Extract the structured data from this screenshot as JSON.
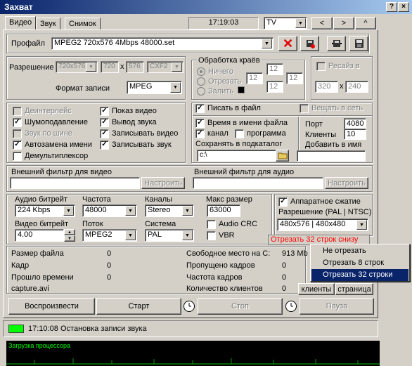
{
  "window": {
    "title": "Захват",
    "btn_help": "?",
    "btn_close": "×"
  },
  "tabs": {
    "video": "Видео",
    "sound": "Звук",
    "snapshot": "Снимок"
  },
  "toolbar": {
    "time": "17:19:03",
    "tv_value": "TV",
    "prev": "<",
    "next": ">",
    "up": "^"
  },
  "profile": {
    "label": "Профайл",
    "value": "MPEG2 720x576 4Mbps 48000.set"
  },
  "resolution": {
    "label": "Разрешение",
    "w_select": "720x576",
    "w": "720",
    "x": "x",
    "h": "576",
    "cxf": "CXF2"
  },
  "record_format": {
    "label": "Формат записи",
    "value": "MPEG"
  },
  "edges": {
    "title": "Обработка краёв",
    "nothing": "Ничего",
    "cut": "Отрезать",
    "fill": "Залить",
    "t": "12",
    "l": "12",
    "r": "12",
    "b": "12"
  },
  "resize": {
    "label": "Ресайз в",
    "w": "320",
    "x": "x",
    "h": "240"
  },
  "options_left": [
    "Деинтерлейс",
    "Шумоподавление",
    "Звук по шине",
    "Автозамена имени",
    "Демультиплексор"
  ],
  "options_left_checked": [
    false,
    true,
    false,
    true,
    false
  ],
  "options_right": [
    "Показ видео",
    "Вывод звука",
    "Записывать видео",
    "Записывать звук"
  ],
  "write_file": {
    "label": "Писать в файл",
    "net": "Вещать в сеть",
    "time_in_name": "Время в имени файла",
    "channel": "канал",
    "program": "программа",
    "save_subdir": "Сохранять в подкаталог",
    "path": "c:\\"
  },
  "net": {
    "port_label": "Порт",
    "port": "4080",
    "clients_label": "Клиенты",
    "clients": "10",
    "add_name": "Добавить в имя"
  },
  "filters": {
    "video_label": "Внешний фильтр для видео",
    "audio_label": "Внешний фильтр для аудио",
    "configure": "Настроить"
  },
  "audio": {
    "bitrate_label": "Аудио битрейт",
    "bitrate": "224 Kbps",
    "freq_label": "Частота",
    "freq": "48000",
    "channels_label": "Каналы",
    "channels": "Stereo",
    "maxsize_label": "Макс размер",
    "maxsize": "63000",
    "video_bitrate_label": "Видео битрейт",
    "video_bitrate": "4.00",
    "stream_label": "Поток",
    "stream": "MPEG2",
    "system_label": "Система",
    "system": "PAL",
    "audio_crc": "Audio CRC",
    "vbr": "VBR"
  },
  "hw": {
    "label": "Аппаратное сжатие",
    "res_label": "Разрешение (PAL | NTSC)",
    "res": "480x576 | 480x480",
    "cut_text": "Отрезать 32 строк снизу"
  },
  "menu": {
    "items": [
      "Не отрезать",
      "Отрезать 8 строк",
      "Отрезать 32 строки"
    ]
  },
  "stats": {
    "filesize_label": "Размер файла",
    "filesize": "0",
    "frame_label": "Кадр",
    "frame": "0",
    "elapsed_label": "Прошло времени",
    "elapsed": "0",
    "filename": "capture.avi",
    "free_label": "Свободное место на C:",
    "free": "913 Mb",
    "dropped_label": "Пропущено кадров",
    "dropped": "0",
    "rate_label": "Частота кадров",
    "rate": "0",
    "clients_label": "Количество клиентов",
    "clients": "0",
    "clients_btn": "клиенты",
    "page_btn": "страница"
  },
  "actions": {
    "play": "Воспроизвести",
    "start": "Старт",
    "stop": "Стоп",
    "pause": "Пауза"
  },
  "status": {
    "time": "17:10:08",
    "text": "Остановка записи звука"
  },
  "cpu": {
    "label": "Загрузка процессора"
  },
  "colors": {
    "titlebar": "#0a246a",
    "accent_red": "#ff0000",
    "status_green": "#00ff00",
    "menu_sel": "#0a246a"
  }
}
